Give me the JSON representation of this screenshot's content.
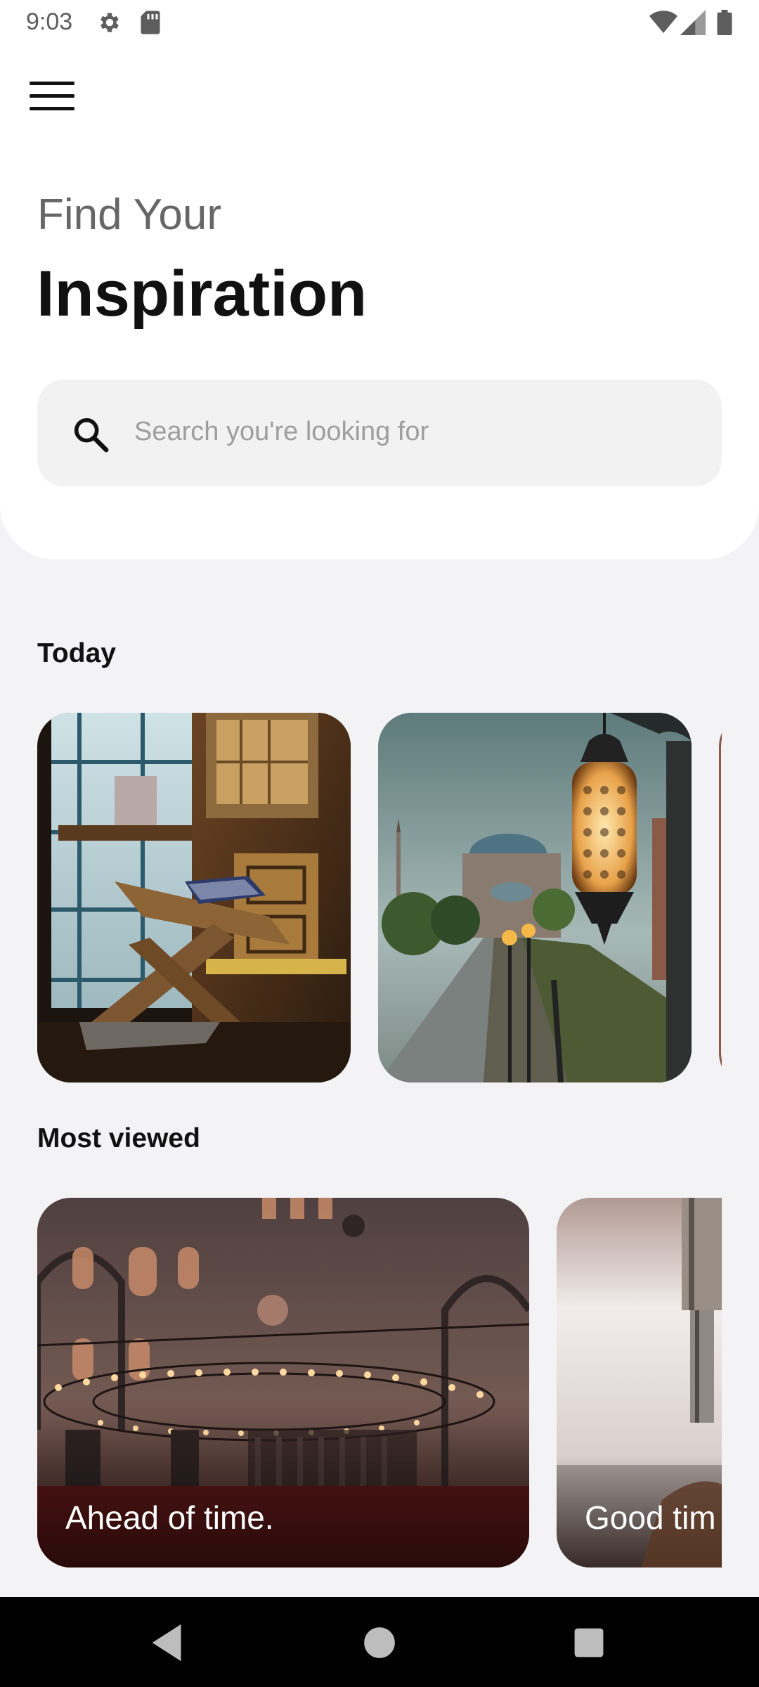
{
  "status_bar": {
    "time": "9:03",
    "icons": [
      "settings-gear-icon",
      "sd-card-icon",
      "wifi-icon",
      "cell-signal-icon",
      "battery-icon"
    ]
  },
  "header": {
    "menu_icon": "hamburger-menu-icon",
    "subtitle": "Find Your",
    "title": "Inspiration"
  },
  "search": {
    "icon": "search-icon",
    "placeholder": "Search you're looking for"
  },
  "today": {
    "label": "Today",
    "cards": [
      {
        "image": "quran-stand-by-window-photo"
      },
      {
        "image": "mosque-lantern-street-photo"
      },
      {
        "image": "partial-third-card-photo"
      }
    ]
  },
  "most_viewed": {
    "label": "Most viewed",
    "cards": [
      {
        "image": "mosque-interior-chandeliers-photo",
        "caption": "Ahead of time."
      },
      {
        "image": "hand-with-rosary-photo",
        "caption": "Good tim"
      }
    ]
  },
  "nav_bar": {
    "buttons": [
      "back-icon",
      "home-icon",
      "recents-icon"
    ]
  },
  "colors": {
    "background": "#f3f3f5",
    "panel": "#ffffff",
    "search_bg": "#f2f2f2",
    "text_primary": "#111111",
    "text_secondary": "#666666",
    "placeholder": "#9e9e9e"
  }
}
